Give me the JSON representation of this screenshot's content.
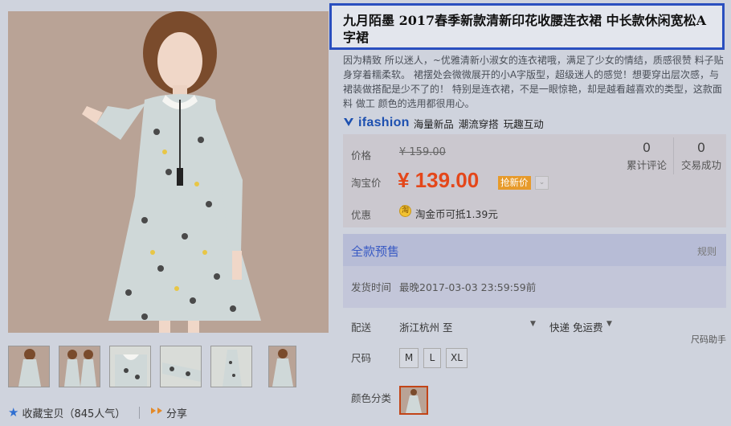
{
  "product": {
    "title": "九月陌墨 2017春季新款清新印花收腰连衣裙 中长款休闲宽松A字裙",
    "description": "因为精致 所以迷人，~优雅清新小淑女的连衣裙哦，满足了少女的情结，质感很赞 料子贴身穿着糯柔软。 裙摆处会微微展开的小A字版型，超级迷人的感觉！想要穿出层次感，与裙装做搭配是少不了的！ 特别是连衣裙，不是一眼惊艳，却是越看越喜欢的类型，这款面料 做工 颜色的选用都很用心。"
  },
  "brand": {
    "logo": "ifashion",
    "tagline": "海量新品 潮流穿搭 玩趣互动"
  },
  "price": {
    "label": "价格",
    "original": "¥ 159.00",
    "taobao_label": "淘宝价",
    "current": "¥ 139.00",
    "rush_badge": "抢新价",
    "promo_label": "优惠",
    "coin_glyph": "淘",
    "coin_text": "淘金币可抵1.39元"
  },
  "stats": [
    {
      "value": "0",
      "label": "累计评论"
    },
    {
      "value": "0",
      "label": "交易成功"
    }
  ],
  "presale": {
    "title": "全款预售",
    "rule_link": "规则",
    "ship_time_label": "发货时间",
    "ship_time_value": "最晚2017-03-03 23:59:59前"
  },
  "delivery": {
    "label": "配送",
    "from": "浙江杭州 至",
    "method": "快递 免运费",
    "size_helper": "尺码助手"
  },
  "sizes": {
    "label": "尺码",
    "options": [
      "M",
      "L",
      "XL"
    ]
  },
  "color": {
    "label": "颜色分类"
  },
  "actions": {
    "favorite": "收藏宝贝（845人气）",
    "share": "分享"
  },
  "colors": {
    "accent_orange": "#e4471a",
    "title_border": "#2a4fbf",
    "presale_blue": "#3a5bc4"
  }
}
